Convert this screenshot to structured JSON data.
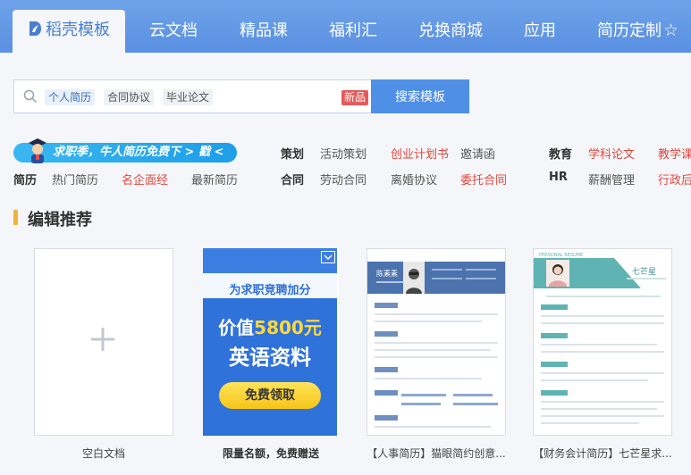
{
  "nav": {
    "tabs": [
      {
        "label": "稻壳模板"
      },
      {
        "label": "云文档"
      },
      {
        "label": "精品课"
      },
      {
        "label": "福利汇"
      },
      {
        "label": "兑换商城"
      },
      {
        "label": "应用"
      },
      {
        "label": "简历定制"
      }
    ],
    "star": "☆"
  },
  "search": {
    "tags": [
      "个人简历",
      "合同协议",
      "毕业论文"
    ],
    "new_badge": "新品",
    "button": "搜索模板"
  },
  "promo": {
    "text": "求职季，牛人简历免费下 > 戳 <"
  },
  "categories": {
    "row1": {
      "label_a": "策划",
      "a": [
        "活动策划",
        "创业计划书",
        "邀请函"
      ],
      "label_b": "教育",
      "b": [
        "学科论文",
        "教学课"
      ]
    },
    "row2": {
      "label_r": "简历",
      "r": [
        "热门简历",
        "名企面经",
        "最新简历"
      ],
      "label_a": "合同",
      "a": [
        "劳动合同",
        "离婚协议",
        "委托合同"
      ],
      "label_b": "HR",
      "b": [
        "薪酬管理",
        "行政后"
      ]
    }
  },
  "section": {
    "title": "编辑推荐"
  },
  "cards": [
    {
      "caption": "空白文档"
    },
    {
      "caption": "限量名额，免费赠送",
      "promo_top": "为求职竞聘加分",
      "promo_price_pre": "价值",
      "promo_price": "5800元",
      "promo_line2": "英语资料",
      "promo_button": "免费领取"
    },
    {
      "caption": "【人事简历】猫眼简约创意...",
      "name": "陈素素"
    },
    {
      "caption": "【财务会计简历】七芒星求...",
      "name": "七芒星",
      "badge": "PERSONAL RESUME"
    }
  ],
  "colors": {
    "nav_bg": "#5a90e2",
    "accent": "#4f8fe6",
    "red": "#e0473d",
    "section_bar": "#f2b33d"
  }
}
